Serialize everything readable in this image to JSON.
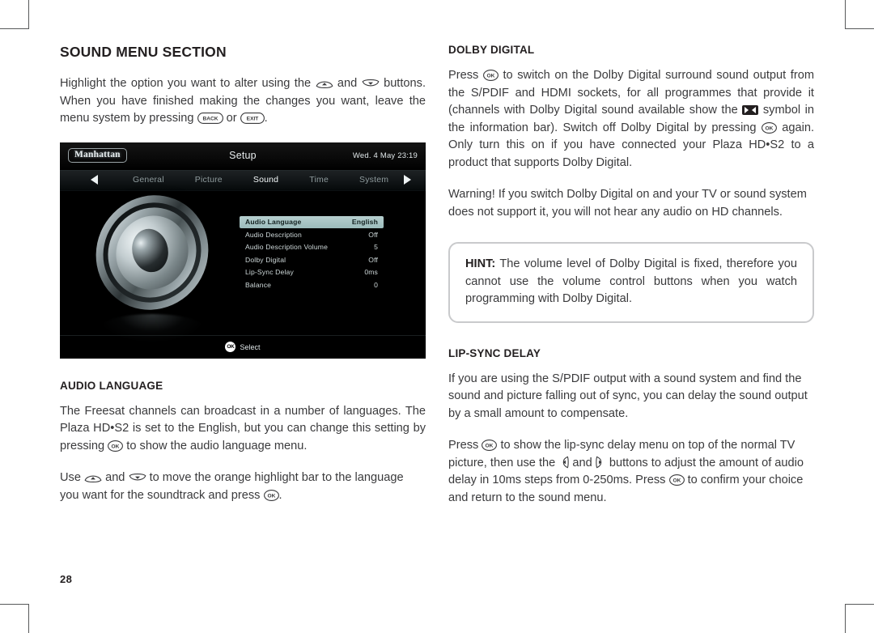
{
  "page": {
    "number": "28"
  },
  "left_column": {
    "section_title": "SOUND MENU SECTION",
    "intro_part1": "Highlight the option you want to alter using the",
    "intro_part2": "and",
    "intro_part3": "buttons. When you have finished making the changes you want, leave the menu system by pressing",
    "intro_part4": "or",
    "intro_part5": ".",
    "keys": {
      "up": "up-arrow",
      "down": "down-arrow",
      "back": "BACK",
      "exit": "EXIT",
      "ok": "OK"
    },
    "audio_language": {
      "title": "AUDIO LANGUAGE",
      "para1_part1": "The Freesat channels can broadcast in a number of languages. The Plaza HD•S2 is set to the English, but you can change this setting by pressing",
      "para1_part2": "to show the audio language menu.",
      "para2_part1": "Use",
      "para2_part2": "and",
      "para2_part3": "to move the orange highlight bar to the language you want for the soundtrack and press",
      "para2_part4": "."
    }
  },
  "tv_screenshot": {
    "logo": "Manhattan",
    "title": "Setup",
    "clock": "Wed. 4 May  23:19",
    "nav_tabs": [
      {
        "label": "General",
        "active": false
      },
      {
        "label": "Picture",
        "active": false
      },
      {
        "label": "Sound",
        "active": true
      },
      {
        "label": "Time",
        "active": false
      },
      {
        "label": "System",
        "active": false
      }
    ],
    "nav_arrow_left": "left-triangle",
    "nav_arrow_right": "right-triangle",
    "menu_items": [
      {
        "label": "Audio Language",
        "value": "English",
        "selected": true
      },
      {
        "label": "Audio Description",
        "value": "Off",
        "selected": false
      },
      {
        "label": "Audio Description Volume",
        "value": "5",
        "selected": false
      },
      {
        "label": "Dolby Digital",
        "value": "Off",
        "selected": false
      },
      {
        "label": "Lip-Sync Delay",
        "value": "0ms",
        "selected": false
      },
      {
        "label": "Balance",
        "value": "0",
        "selected": false
      }
    ],
    "footer": {
      "ok_label": "OK",
      "action": "Select"
    },
    "colors": {
      "background": "#000000",
      "highlight_bar": "#9cbcbc",
      "active_tab_text": "#f2f7f8",
      "inactive_tab_text": "#8e9a9c"
    }
  },
  "right_column": {
    "dolby_digital": {
      "title": "DOLBY DIGITAL",
      "para1_part1": "Press",
      "para1_part2": "to switch on the Dolby Digital surround sound output from the S/PDIF and HDMI sockets, for all programmes that provide it (channels with Dolby Digital sound available show the",
      "para1_part3": "symbol in the information bar). Switch off Dolby Digital by pressing",
      "para1_part4": "again. Only turn this on if you have connected your Plaza HD•S2 to a product that supports Dolby Digital.",
      "para2": "Warning! If you switch Dolby Digital on and your TV or sound system does not support it, you will not hear any audio on HD channels."
    },
    "hint": {
      "label": "HINT:",
      "text": " The volume level of Dolby Digital is fixed, therefore you cannot use the volume control buttons when you watch programming with Dolby Digital."
    },
    "lip_sync_delay": {
      "title": "LIP-SYNC DELAY",
      "para1": "If you are using the S/PDIF output with a sound system and find the sound and picture falling out of sync, you can delay the sound output by a small amount to compensate.",
      "para2_part1": "Press",
      "para2_part2": "to show the lip-sync delay menu on top of the normal TV picture, then use the",
      "para2_part3": "and",
      "para2_part4": "buttons to adjust the amount of audio delay in 10ms steps from 0-250ms. Press",
      "para2_part5": "to confirm your choice and return to the sound menu."
    },
    "keys": {
      "ok": "OK",
      "left": "left-arrow",
      "right": "right-arrow"
    }
  }
}
